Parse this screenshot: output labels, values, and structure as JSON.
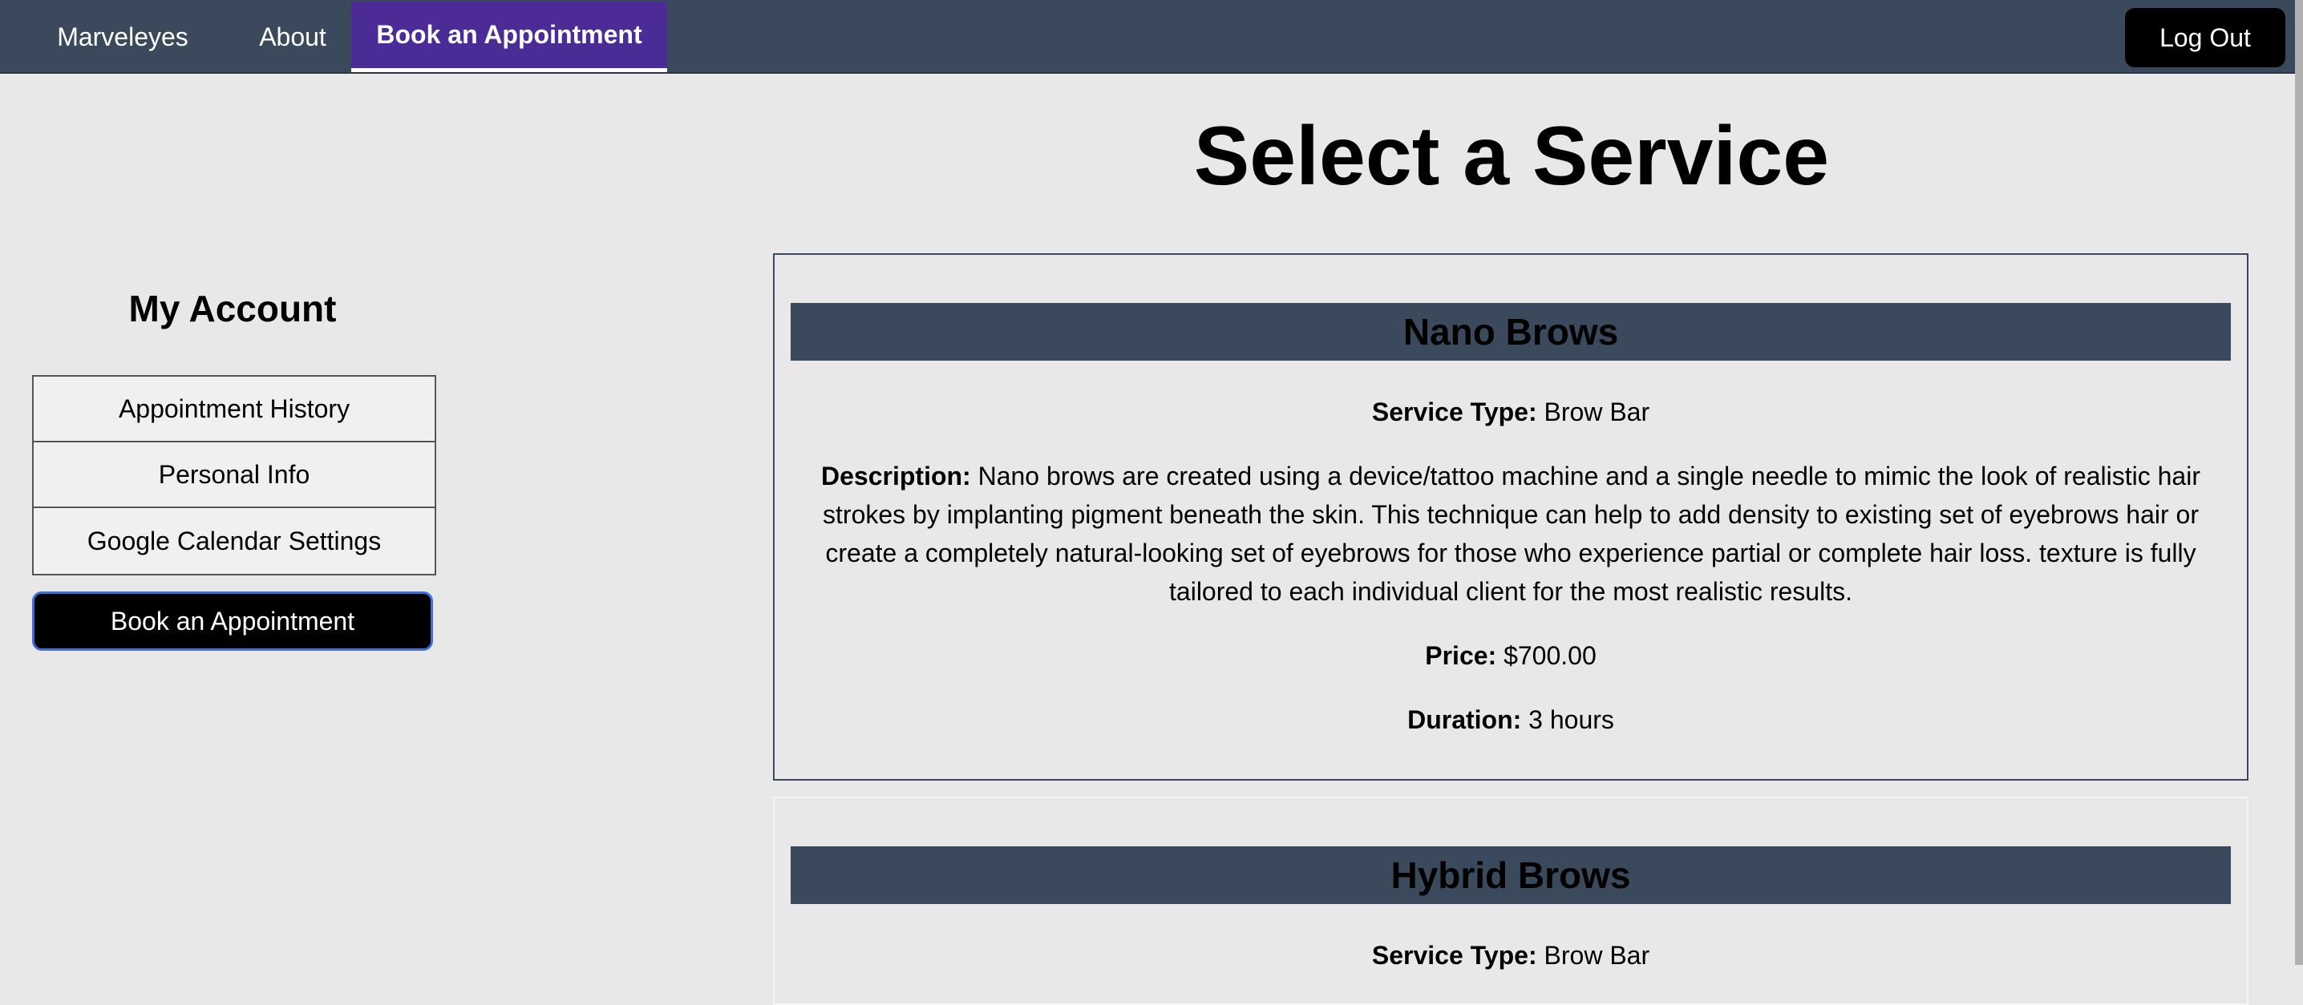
{
  "nav": {
    "brand": "Marveleyes",
    "about": "About",
    "book": "Book an Appointment",
    "logout": "Log Out"
  },
  "page_title": "Select a Service",
  "sidebar": {
    "title": "My Account",
    "items": [
      {
        "label": "Appointment History"
      },
      {
        "label": "Personal Info"
      },
      {
        "label": "Google Calendar Settings"
      }
    ],
    "book_button": "Book an Appointment"
  },
  "labels": {
    "service_type": "Service Type:",
    "description": "Description:",
    "price": "Price:",
    "duration": "Duration:"
  },
  "services": [
    {
      "name": "Nano Brows",
      "type": "Brow Bar",
      "description": "Nano brows are created using a device/tattoo machine and a single needle to mimic the look of realistic hair strokes by implanting pigment beneath the skin. This technique can help to add density to existing set of eyebrows hair or create a completely natural-looking set of eyebrows for those who experience partial or complete hair loss. texture is fully tailored to each individual client for the most realistic results.",
      "price": "$700.00",
      "duration": "3 hours"
    },
    {
      "name": "Hybrid Brows",
      "type": "Brow Bar"
    }
  ],
  "colors": {
    "nav_bg": "#3a4a5c",
    "nav_active": "#4b2c96",
    "page_bg": "#e8e8e8",
    "button_bg": "#000000"
  }
}
